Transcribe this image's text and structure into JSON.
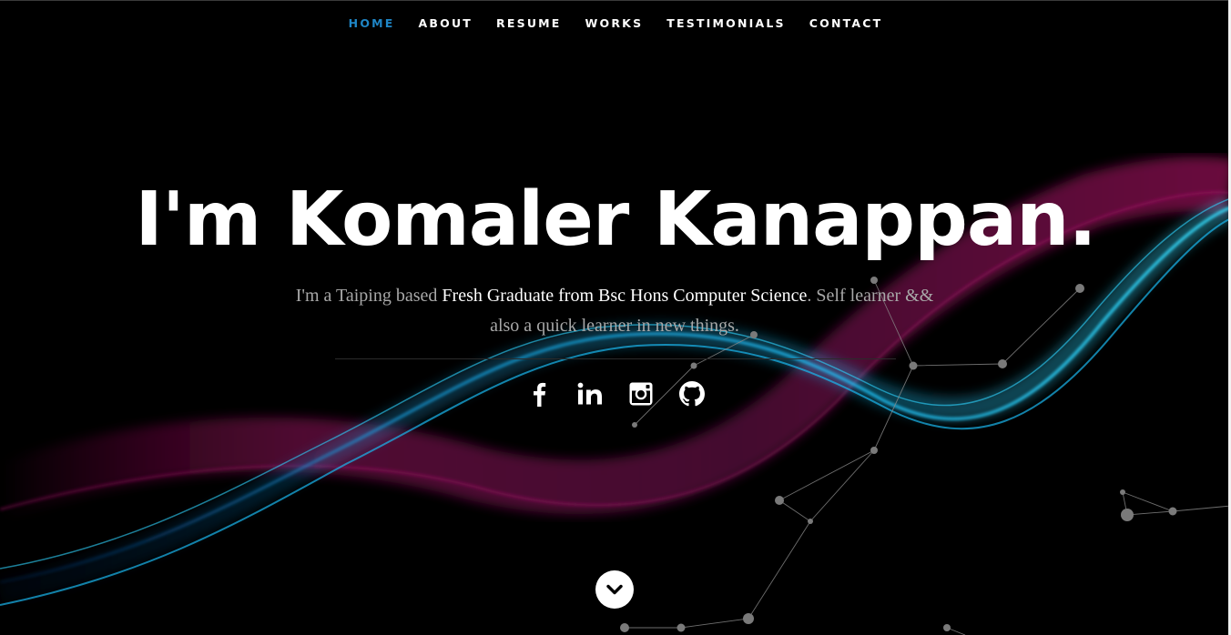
{
  "nav": {
    "items": [
      {
        "label": "HOME",
        "active": true
      },
      {
        "label": "ABOUT",
        "active": false
      },
      {
        "label": "RESUME",
        "active": false
      },
      {
        "label": "WORKS",
        "active": false
      },
      {
        "label": "TESTIMONIALS",
        "active": false
      },
      {
        "label": "CONTACT",
        "active": false
      }
    ],
    "active_color": "#1f86c6"
  },
  "hero": {
    "headline": "I'm Komaler Kanappan.",
    "tagline": {
      "prefix": "I'm a Taiping based ",
      "highlight": "Fresh Graduate from Bsc Hons Computer Science",
      "suffix": ". Self learner && also a quick learner in new things."
    }
  },
  "social": [
    {
      "icon": "facebook-icon"
    },
    {
      "icon": "linkedin-icon"
    },
    {
      "icon": "instagram-icon"
    },
    {
      "icon": "github-icon"
    }
  ],
  "scroll_down": {
    "icon": "chevron-down-icon"
  },
  "colors": {
    "background": "#000000",
    "wave_cyan": "#1ec8ff",
    "wave_magenta": "#a0106a",
    "star_gray": "#8a8a8a"
  }
}
